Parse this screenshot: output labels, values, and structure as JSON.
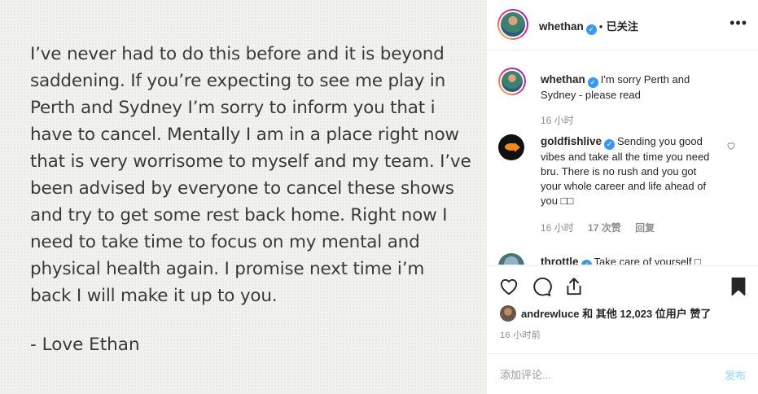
{
  "post": {
    "note_lines": [
      "I’ve never had to do this before and it is beyond",
      "saddening. If you’re expecting to see me play in",
      "Perth and Sydney I’m sorry to inform you that i",
      "have to cancel. Mentally I am in a place right now",
      "that is very worrisome to myself and my team. I’ve",
      "been advised by everyone to cancel these shows",
      "and try to get some rest back home. Right now I",
      "need to take time to focus on my mental and",
      "physical health again. I promise next time i’m",
      "back I will make it up to you."
    ],
    "signature": "- Love Ethan"
  },
  "header": {
    "username": "whethan",
    "dot": "•",
    "follow_status": "已关注",
    "more": "•••"
  },
  "caption": {
    "username": "whethan",
    "text": "I'm sorry Perth and Sydney - please read",
    "time": "16 小时"
  },
  "comments": [
    {
      "username": "goldfishlive",
      "text": "Sending you good vibes and take all the time you need bru. There is no rush and you got your whole career and life ahead of you □□",
      "time": "16 小时",
      "likes": "17 次赞",
      "reply": "回复"
    },
    {
      "username": "throttle",
      "text": "Take care of yourself □"
    }
  ],
  "likes": {
    "user": "andrewluce",
    "connector": "和",
    "others": "其他 12,023 位用户",
    "suffix": "赞了"
  },
  "timestamp": "16 小时前",
  "comment_box": {
    "placeholder": "添加评论...",
    "post_label": "发布"
  },
  "verified_mark": "✓",
  "colors": {
    "verified": "#3897f0",
    "post_button": "#b2dffc",
    "muted": "#8e8e8e"
  }
}
